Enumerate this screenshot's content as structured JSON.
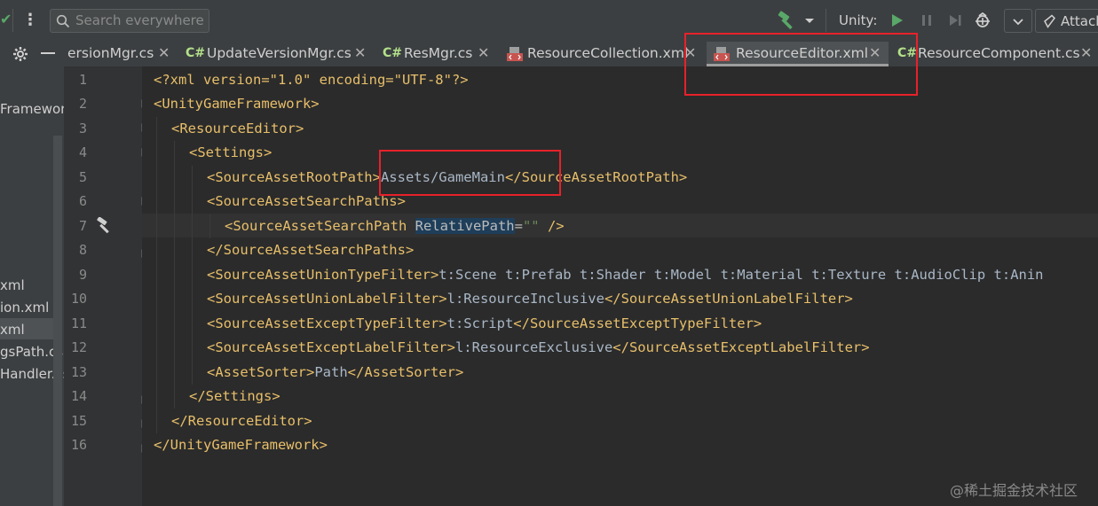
{
  "toolbar": {
    "search_placeholder": "Search everywhere",
    "unity_label": "Unity:",
    "attach_label": "Attach"
  },
  "tabs": [
    {
      "label": "ersionMgr.cs",
      "icon": "csharp-icon"
    },
    {
      "label": "UpdateVersionMgr.cs",
      "icon": "csharp-icon",
      "badge": "C#"
    },
    {
      "label": "ResMgr.cs",
      "icon": "csharp-icon",
      "badge": "C#"
    },
    {
      "label": "ResourceCollection.xml",
      "icon": "xml-file-icon"
    },
    {
      "label": "ResourceEditor.xml",
      "icon": "xml-file-icon",
      "active": true
    },
    {
      "label": "ResourceComponent.cs",
      "icon": "csharp-icon",
      "badge": "C#"
    }
  ],
  "sidebar": {
    "items": [
      {
        "label": "Framewor"
      },
      {
        "label": "xml"
      },
      {
        "label": "ion.xml"
      },
      {
        "label": "xml",
        "selected": true
      },
      {
        "label": "gsPath.cs"
      },
      {
        "label": "Handler.cs"
      }
    ]
  },
  "editor": {
    "line_numbers": [
      "1",
      "2",
      "3",
      "4",
      "5",
      "6",
      "7",
      "8",
      "9",
      "10",
      "11",
      "12",
      "13",
      "14",
      "15",
      "16"
    ],
    "lines": {
      "l1_decl": "<?xml version=\"1.0\" encoding=\"UTF-8\"?>",
      "l2_open": "<UnityGameFramework>",
      "l3_open": "<ResourceEditor>",
      "l4_open": "<Settings>",
      "l5_open": "<SourceAssetRootPath>",
      "l5_text": "Assets/GameMain",
      "l5_close": "</SourceAssetRootPath>",
      "l6_open": "<SourceAssetSearchPaths>",
      "l7_tag": "<SourceAssetSearchPath ",
      "l7_attr": "RelativePath",
      "l7_eq": "=",
      "l7_val": "\"\"",
      "l7_end": " />",
      "l8_close": "</SourceAssetSearchPaths>",
      "l9_open": "<SourceAssetUnionTypeFilter>",
      "l9_text": "t:Scene t:Prefab t:Shader t:Model t:Material t:Texture t:AudioClip t:Anin",
      "l10_open": "<SourceAssetUnionLabelFilter>",
      "l10_text": "l:ResourceInclusive",
      "l10_close": "</SourceAssetUnionLabelFilter>",
      "l11_open": "<SourceAssetExceptTypeFilter>",
      "l11_text": "t:Script",
      "l11_close": "</SourceAssetExceptTypeFilter>",
      "l12_open": "<SourceAssetExceptLabelFilter>",
      "l12_text": "l:ResourceExclusive",
      "l12_close": "</SourceAssetExceptLabelFilter>",
      "l13_open": "<AssetSorter>",
      "l13_text": "Path",
      "l13_close": "</AssetSorter>",
      "l14_close": "</Settings>",
      "l15_close": "</ResourceEditor>",
      "l16_close": "</UnityGameFramework>"
    }
  },
  "watermark": "@稀土掘金技术社区",
  "colors": {
    "tag": "#e8bf6a",
    "string": "#6a8759",
    "text": "#a9b7c6",
    "highlight_box": "#e8212a"
  }
}
